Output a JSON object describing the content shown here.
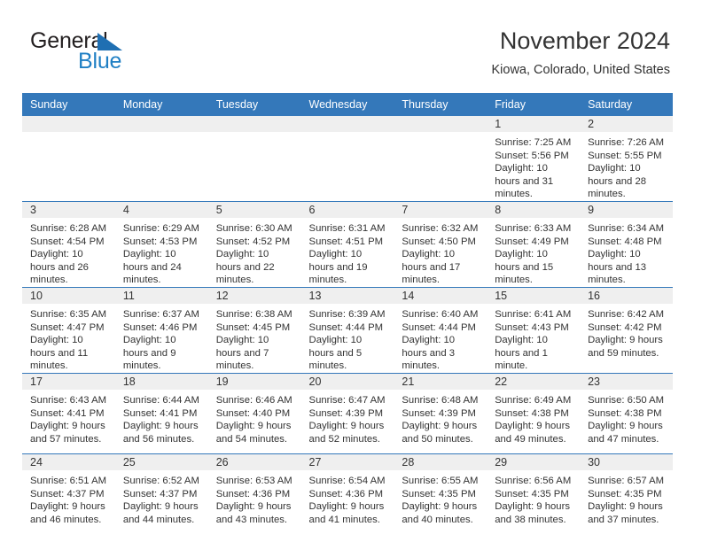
{
  "brand": {
    "word_one": "General",
    "word_two": "Blue",
    "triangle_icon": "blue-triangle-icon"
  },
  "header": {
    "title": "November 2024",
    "subtitle": "Kiowa, Colorado, United States"
  },
  "colors": {
    "header_blue": "#3478ba",
    "brand_blue": "#1f7fc4",
    "daynum_band": "#efefef",
    "text": "#333333"
  },
  "calendar": {
    "weekday_headers": [
      "Sunday",
      "Monday",
      "Tuesday",
      "Wednesday",
      "Thursday",
      "Friday",
      "Saturday"
    ],
    "labels": {
      "sunrise": "Sunrise:",
      "sunset": "Sunset:",
      "daylight": "Daylight:"
    },
    "weeks": [
      [
        {
          "day": ""
        },
        {
          "day": ""
        },
        {
          "day": ""
        },
        {
          "day": ""
        },
        {
          "day": ""
        },
        {
          "day": "1",
          "sunrise": "Sunrise: 7:25 AM",
          "sunset": "Sunset: 5:56 PM",
          "daylight": "Daylight: 10 hours and 31 minutes."
        },
        {
          "day": "2",
          "sunrise": "Sunrise: 7:26 AM",
          "sunset": "Sunset: 5:55 PM",
          "daylight": "Daylight: 10 hours and 28 minutes."
        }
      ],
      [
        {
          "day": "3",
          "sunrise": "Sunrise: 6:28 AM",
          "sunset": "Sunset: 4:54 PM",
          "daylight": "Daylight: 10 hours and 26 minutes."
        },
        {
          "day": "4",
          "sunrise": "Sunrise: 6:29 AM",
          "sunset": "Sunset: 4:53 PM",
          "daylight": "Daylight: 10 hours and 24 minutes."
        },
        {
          "day": "5",
          "sunrise": "Sunrise: 6:30 AM",
          "sunset": "Sunset: 4:52 PM",
          "daylight": "Daylight: 10 hours and 22 minutes."
        },
        {
          "day": "6",
          "sunrise": "Sunrise: 6:31 AM",
          "sunset": "Sunset: 4:51 PM",
          "daylight": "Daylight: 10 hours and 19 minutes."
        },
        {
          "day": "7",
          "sunrise": "Sunrise: 6:32 AM",
          "sunset": "Sunset: 4:50 PM",
          "daylight": "Daylight: 10 hours and 17 minutes."
        },
        {
          "day": "8",
          "sunrise": "Sunrise: 6:33 AM",
          "sunset": "Sunset: 4:49 PM",
          "daylight": "Daylight: 10 hours and 15 minutes."
        },
        {
          "day": "9",
          "sunrise": "Sunrise: 6:34 AM",
          "sunset": "Sunset: 4:48 PM",
          "daylight": "Daylight: 10 hours and 13 minutes."
        }
      ],
      [
        {
          "day": "10",
          "sunrise": "Sunrise: 6:35 AM",
          "sunset": "Sunset: 4:47 PM",
          "daylight": "Daylight: 10 hours and 11 minutes."
        },
        {
          "day": "11",
          "sunrise": "Sunrise: 6:37 AM",
          "sunset": "Sunset: 4:46 PM",
          "daylight": "Daylight: 10 hours and 9 minutes."
        },
        {
          "day": "12",
          "sunrise": "Sunrise: 6:38 AM",
          "sunset": "Sunset: 4:45 PM",
          "daylight": "Daylight: 10 hours and 7 minutes."
        },
        {
          "day": "13",
          "sunrise": "Sunrise: 6:39 AM",
          "sunset": "Sunset: 4:44 PM",
          "daylight": "Daylight: 10 hours and 5 minutes."
        },
        {
          "day": "14",
          "sunrise": "Sunrise: 6:40 AM",
          "sunset": "Sunset: 4:44 PM",
          "daylight": "Daylight: 10 hours and 3 minutes."
        },
        {
          "day": "15",
          "sunrise": "Sunrise: 6:41 AM",
          "sunset": "Sunset: 4:43 PM",
          "daylight": "Daylight: 10 hours and 1 minute."
        },
        {
          "day": "16",
          "sunrise": "Sunrise: 6:42 AM",
          "sunset": "Sunset: 4:42 PM",
          "daylight": "Daylight: 9 hours and 59 minutes."
        }
      ],
      [
        {
          "day": "17",
          "sunrise": "Sunrise: 6:43 AM",
          "sunset": "Sunset: 4:41 PM",
          "daylight": "Daylight: 9 hours and 57 minutes."
        },
        {
          "day": "18",
          "sunrise": "Sunrise: 6:44 AM",
          "sunset": "Sunset: 4:41 PM",
          "daylight": "Daylight: 9 hours and 56 minutes."
        },
        {
          "day": "19",
          "sunrise": "Sunrise: 6:46 AM",
          "sunset": "Sunset: 4:40 PM",
          "daylight": "Daylight: 9 hours and 54 minutes."
        },
        {
          "day": "20",
          "sunrise": "Sunrise: 6:47 AM",
          "sunset": "Sunset: 4:39 PM",
          "daylight": "Daylight: 9 hours and 52 minutes."
        },
        {
          "day": "21",
          "sunrise": "Sunrise: 6:48 AM",
          "sunset": "Sunset: 4:39 PM",
          "daylight": "Daylight: 9 hours and 50 minutes."
        },
        {
          "day": "22",
          "sunrise": "Sunrise: 6:49 AM",
          "sunset": "Sunset: 4:38 PM",
          "daylight": "Daylight: 9 hours and 49 minutes."
        },
        {
          "day": "23",
          "sunrise": "Sunrise: 6:50 AM",
          "sunset": "Sunset: 4:38 PM",
          "daylight": "Daylight: 9 hours and 47 minutes."
        }
      ],
      [
        {
          "day": "24",
          "sunrise": "Sunrise: 6:51 AM",
          "sunset": "Sunset: 4:37 PM",
          "daylight": "Daylight: 9 hours and 46 minutes."
        },
        {
          "day": "25",
          "sunrise": "Sunrise: 6:52 AM",
          "sunset": "Sunset: 4:37 PM",
          "daylight": "Daylight: 9 hours and 44 minutes."
        },
        {
          "day": "26",
          "sunrise": "Sunrise: 6:53 AM",
          "sunset": "Sunset: 4:36 PM",
          "daylight": "Daylight: 9 hours and 43 minutes."
        },
        {
          "day": "27",
          "sunrise": "Sunrise: 6:54 AM",
          "sunset": "Sunset: 4:36 PM",
          "daylight": "Daylight: 9 hours and 41 minutes."
        },
        {
          "day": "28",
          "sunrise": "Sunrise: 6:55 AM",
          "sunset": "Sunset: 4:35 PM",
          "daylight": "Daylight: 9 hours and 40 minutes."
        },
        {
          "day": "29",
          "sunrise": "Sunrise: 6:56 AM",
          "sunset": "Sunset: 4:35 PM",
          "daylight": "Daylight: 9 hours and 38 minutes."
        },
        {
          "day": "30",
          "sunrise": "Sunrise: 6:57 AM",
          "sunset": "Sunset: 4:35 PM",
          "daylight": "Daylight: 9 hours and 37 minutes."
        }
      ]
    ]
  }
}
